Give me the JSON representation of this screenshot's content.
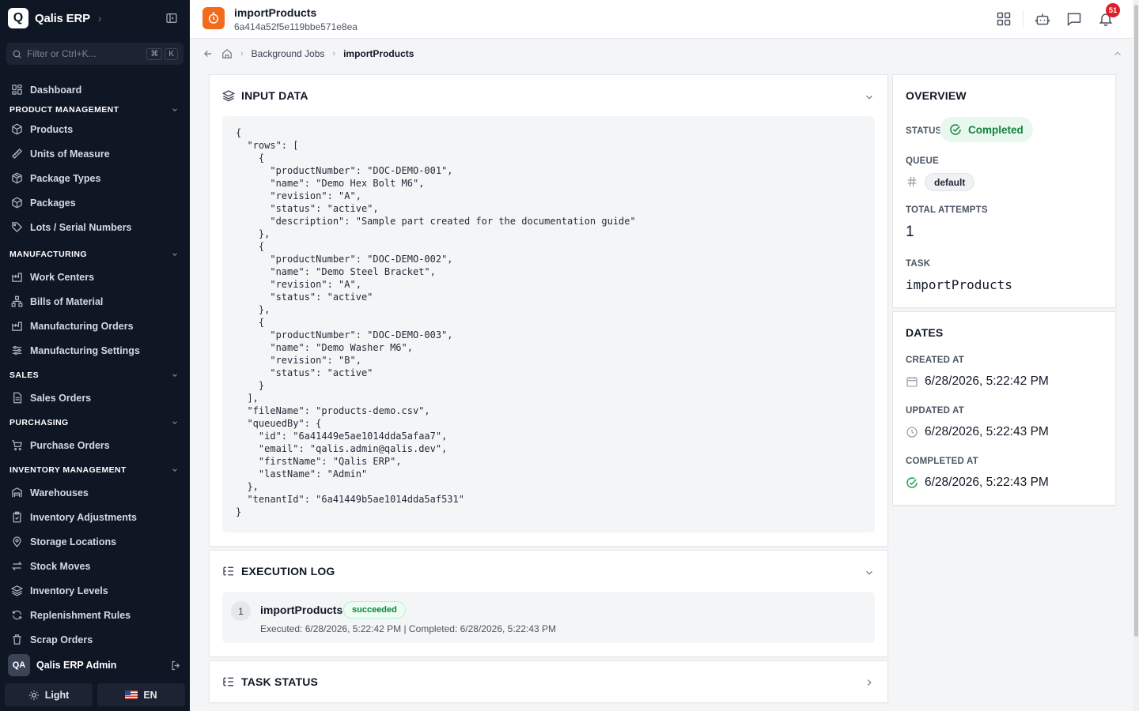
{
  "app": {
    "name": "Qalis ERP",
    "logo_letter": "Q"
  },
  "search": {
    "placeholder": "Filter or Ctrl+K...",
    "kbd1": "⌘",
    "kbd2": "K"
  },
  "nav": {
    "dashboard": "Dashboard",
    "product_management": {
      "title": "PRODUCT MANAGEMENT",
      "items": [
        "Products",
        "Units of Measure",
        "Package Types",
        "Packages",
        "Lots / Serial Numbers"
      ]
    },
    "manufacturing": {
      "title": "MANUFACTURING",
      "items": [
        "Work Centers",
        "Bills of Material",
        "Manufacturing Orders",
        "Manufacturing Settings"
      ]
    },
    "sales": {
      "title": "SALES",
      "items": [
        "Sales Orders"
      ]
    },
    "purchasing": {
      "title": "PURCHASING",
      "items": [
        "Purchase Orders"
      ]
    },
    "inventory": {
      "title": "INVENTORY MANAGEMENT",
      "items": [
        "Warehouses",
        "Inventory Adjustments",
        "Storage Locations",
        "Stock Moves",
        "Inventory Levels",
        "Replenishment Rules",
        "Scrap Orders"
      ]
    }
  },
  "user": {
    "initials": "QA",
    "name": "Qalis ERP Admin"
  },
  "footer": {
    "theme_label": "Light",
    "lang_label": "EN"
  },
  "header": {
    "title": "importProducts",
    "job_id": "6a414a52f5e119bbe571e8ea",
    "notifications": "51"
  },
  "breadcrumb": {
    "parent": "Background Jobs",
    "current": "importProducts"
  },
  "input_data": {
    "title": "INPUT DATA",
    "json": "{\n  \"rows\": [\n    {\n      \"productNumber\": \"DOC-DEMO-001\",\n      \"name\": \"Demo Hex Bolt M6\",\n      \"revision\": \"A\",\n      \"status\": \"active\",\n      \"description\": \"Sample part created for the documentation guide\"\n    },\n    {\n      \"productNumber\": \"DOC-DEMO-002\",\n      \"name\": \"Demo Steel Bracket\",\n      \"revision\": \"A\",\n      \"status\": \"active\"\n    },\n    {\n      \"productNumber\": \"DOC-DEMO-003\",\n      \"name\": \"Demo Washer M6\",\n      \"revision\": \"B\",\n      \"status\": \"active\"\n    }\n  ],\n  \"fileName\": \"products-demo.csv\",\n  \"queuedBy\": {\n    \"id\": \"6a41449e5ae1014dda5afaa7\",\n    \"email\": \"qalis.admin@qalis.dev\",\n    \"firstName\": \"Qalis ERP\",\n    \"lastName\": \"Admin\"\n  },\n  \"tenantId\": \"6a41449b5ae1014dda5af531\"\n}"
  },
  "execution_log": {
    "title": "EXECUTION LOG",
    "entries": [
      {
        "index": "1",
        "name": "importProducts",
        "status": "succeeded",
        "meta": "Executed: 6/28/2026, 5:22:42 PM | Completed: 6/28/2026, 5:22:43 PM"
      }
    ]
  },
  "task_status": {
    "title": "TASK STATUS"
  },
  "overview": {
    "title": "OVERVIEW",
    "status_label": "STATUS",
    "status_value": "Completed",
    "queue_label": "QUEUE",
    "queue_value": "default",
    "attempts_label": "TOTAL ATTEMPTS",
    "attempts_value": "1",
    "task_label": "TASK",
    "task_value": "importProducts"
  },
  "dates": {
    "title": "DATES",
    "created_label": "CREATED AT",
    "created_value": "6/28/2026, 5:22:42 PM",
    "updated_label": "UPDATED AT",
    "updated_value": "6/28/2026, 5:22:43 PM",
    "completed_label": "COMPLETED AT",
    "completed_value": "6/28/2026, 5:22:43 PM"
  },
  "colors": {
    "sidebar_bg": "#0f1624",
    "accent_orange": "#f26b1d",
    "success_green": "#15803d",
    "badge_red": "#e11d2a"
  }
}
